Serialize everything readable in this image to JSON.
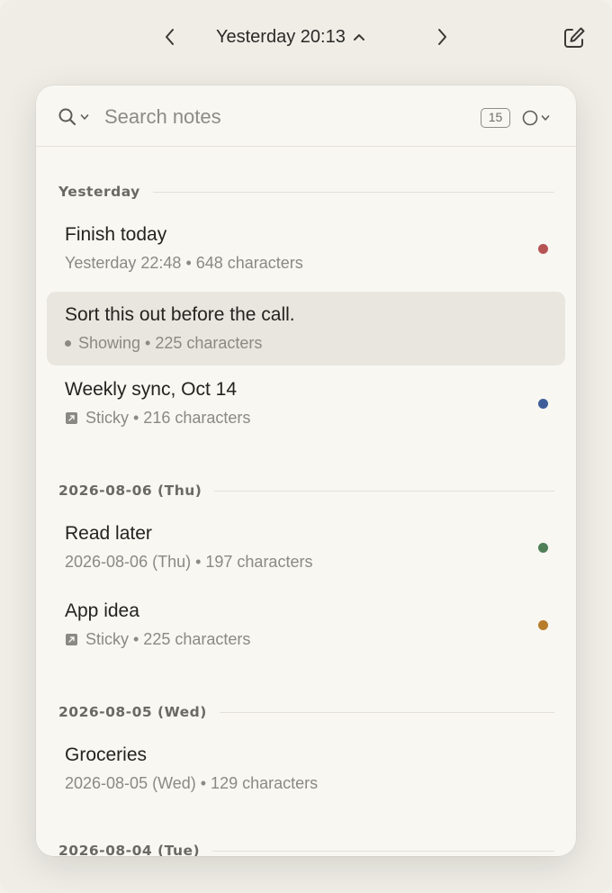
{
  "topbar": {
    "date_title": "Yesterday 20:13"
  },
  "search": {
    "placeholder": "Search notes",
    "count": "15"
  },
  "groups": [
    {
      "label": "Yesterday"
    },
    {
      "label": "2026-08-06 (Thu)"
    },
    {
      "label": "2026-08-05 (Wed)"
    },
    {
      "label": "2026-08-04 (Tue)"
    }
  ],
  "notes": [
    {
      "title": "Finish today",
      "meta": "Yesterday 22:48 • 648 characters",
      "color": "#b65454"
    },
    {
      "title": "Sort this out before the call.",
      "meta": "Showing • 225 characters"
    },
    {
      "title": "Weekly sync, Oct 14",
      "meta": "Sticky • 216 characters",
      "color": "#3f5e99"
    },
    {
      "title": "Read later",
      "meta": "2026-08-06 (Thu) • 197 characters",
      "color": "#4f7f57"
    },
    {
      "title": "App idea",
      "meta": "Sticky • 225 characters",
      "color": "#b87d2a"
    },
    {
      "title": "Groceries",
      "meta": "2026-08-05 (Wed) • 129 characters"
    }
  ],
  "icons": {
    "prev": "chevron-left-icon",
    "next": "chevron-right-icon",
    "title_toggle": "chevron-up-icon",
    "compose": "compose-icon",
    "search": "search-icon",
    "filter": "circle-icon",
    "sticky": "sticky-icon"
  }
}
